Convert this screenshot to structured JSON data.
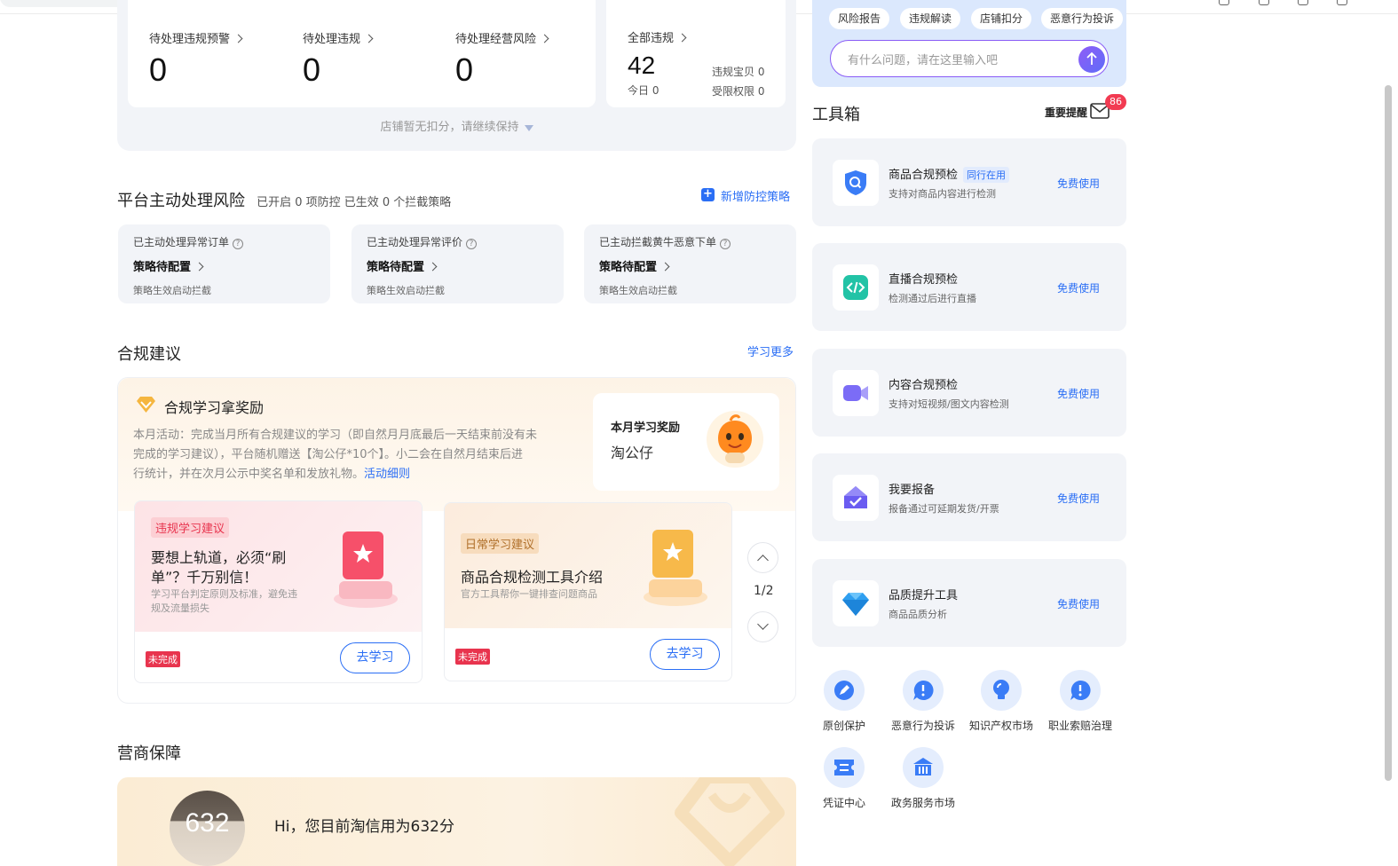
{
  "stats": {
    "items": [
      {
        "label": "待处理违规预警",
        "value": "0"
      },
      {
        "label": "待处理违规",
        "value": "0"
      },
      {
        "label": "待处理经营风险",
        "value": "0"
      }
    ],
    "total": {
      "label": "全部违规",
      "value": "42",
      "today": "今日 0",
      "baobei": "违规宝贝 0",
      "shouxian": "受限权限 0"
    },
    "no_deduction": "店铺暂无扣分，请继续保持"
  },
  "risk": {
    "title": "平台主动处理风险",
    "subtitle": "已开启 0 项防控 已生效 0 个拦截策略",
    "add_link": "新增防控策略",
    "cards": [
      {
        "title": "已主动处理异常订单",
        "status": "策略待配置",
        "desc": "策略生效启动拦截"
      },
      {
        "title": "已主动处理异常评价",
        "status": "策略待配置",
        "desc": "策略生效启动拦截"
      },
      {
        "title": "已主动拦截黄牛恶意下单",
        "status": "策略待配置",
        "desc": "策略生效启动拦截"
      }
    ]
  },
  "compliance": {
    "title": "合规建议",
    "more": "学习更多",
    "reward_title": "合规学习拿奖励",
    "desc_lines": [
      "本月活动：完成当月所有合规建议的学习（即自然月月底最后一天结束前没有未",
      "完成的学习建议），平台随机赠送【淘公仔*10个】。小二会在自然月结束后进",
      "行统计，并在次月公示中奖名单和发放礼物。"
    ],
    "rules_link": "活动细则",
    "monthly_label": "本月学习奖励",
    "monthly_prize": "淘公仔",
    "cards": [
      {
        "tag": "违规学习建议",
        "title_lines": [
          "要想上轨道，必须“刷",
          "单”？千万别信！"
        ],
        "desc_lines": [
          "学习平台判定原则及标准，避免违",
          "规及流量损失"
        ],
        "status": "未完成",
        "button": "去学习"
      },
      {
        "tag": "日常学习建议",
        "title_lines": [
          "商品合规检测工具介绍"
        ],
        "desc_lines": [
          "官方工具帮你一键排查问题商品"
        ],
        "status": "未完成",
        "button": "去学习"
      }
    ],
    "pager": "1/2"
  },
  "merchant": {
    "title": "营商保障",
    "score": "632",
    "greeting": "Hi，您目前淘信用为632分"
  },
  "ai": {
    "chips": [
      "风险报告",
      "违规解读",
      "店铺扣分",
      "恶意行为投诉"
    ],
    "placeholder": "有什么问题，请在这里输入吧"
  },
  "toolbox": {
    "title": "工具箱",
    "reminder": "重要提醒",
    "badge": "86",
    "tools": [
      {
        "name": "商品合规预检",
        "badge": "同行在用",
        "desc": "支持对商品内容进行检测",
        "action": "免费使用",
        "icon": "shield-search-icon"
      },
      {
        "name": "直播合规预检",
        "badge": "",
        "desc": "检测通过后进行直播",
        "action": "免费使用",
        "icon": "code-icon"
      },
      {
        "name": "内容合规预检",
        "badge": "",
        "desc": "支持对短视频/图文内容检测",
        "action": "免费使用",
        "icon": "video-camera-icon"
      },
      {
        "name": "我要报备",
        "badge": "",
        "desc": "报备通过可延期发货/开票",
        "action": "免费使用",
        "icon": "home-check-icon"
      },
      {
        "name": "品质提升工具",
        "badge": "",
        "desc": "商品品质分析",
        "action": "免费使用",
        "icon": "diamond-icon"
      }
    ],
    "quick": [
      {
        "label": "原创保护"
      },
      {
        "label": "恶意行为投诉"
      },
      {
        "label": "知识产权市场"
      },
      {
        "label": "职业索赔治理"
      },
      {
        "label": "凭证中心"
      },
      {
        "label": "政务服务市场"
      }
    ]
  },
  "colors": {
    "accent": "#2a6ef5",
    "danger": "#e8344e",
    "ai_bg": "#dbe8fd"
  }
}
